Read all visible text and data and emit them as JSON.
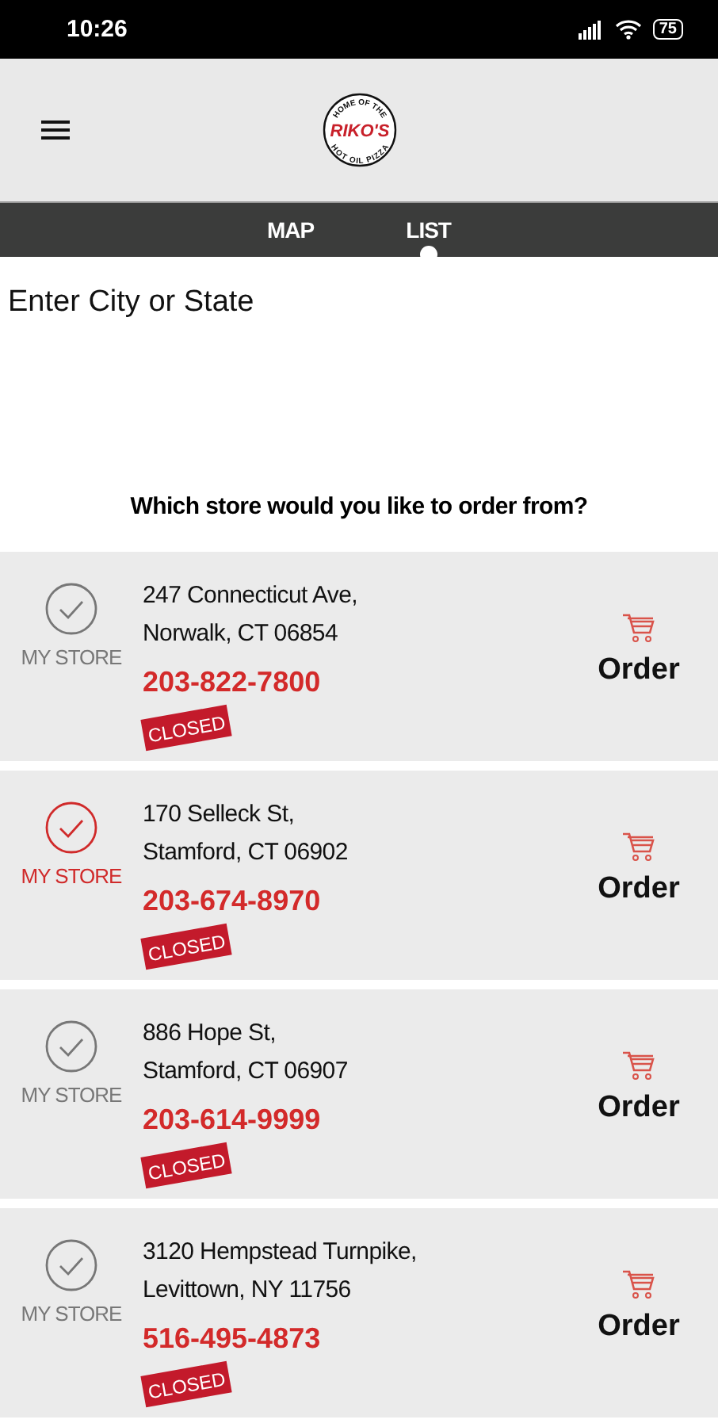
{
  "status_bar": {
    "time": "10:26",
    "battery": "75"
  },
  "header": {
    "logo": {
      "top": "HOME OF THE",
      "name": "RIKO'S",
      "bottom": "HOT OIL PIZZA"
    }
  },
  "tabs": [
    {
      "label": "MAP",
      "selected": false
    },
    {
      "label": "LIST",
      "selected": true
    }
  ],
  "search": {
    "placeholder": "Enter City or State"
  },
  "prompt": "Which store would you like to order from?",
  "stores": [
    {
      "address_line_1": "247 Connecticut Ave,",
      "address_line_2": "Norwalk, CT 06854",
      "phone": "203-822-7800",
      "status": "CLOSED",
      "my_store_label": "MY STORE",
      "selected": false,
      "order_label": "Order"
    },
    {
      "address_line_1": "170 Selleck St,",
      "address_line_2": "Stamford, CT 06902",
      "phone": "203-674-8970",
      "status": "CLOSED",
      "my_store_label": "MY STORE",
      "selected": true,
      "order_label": "Order"
    },
    {
      "address_line_1": "886 Hope St,",
      "address_line_2": "Stamford, CT 06907",
      "phone": "203-614-9999",
      "status": "CLOSED",
      "my_store_label": "MY STORE",
      "selected": false,
      "order_label": "Order"
    },
    {
      "address_line_1": "3120 Hempstead Turnpike,",
      "address_line_2": "Levittown, NY 11756",
      "phone": "516-495-4873",
      "status": "CLOSED",
      "my_store_label": "MY STORE",
      "selected": false,
      "order_label": "Order"
    }
  ]
}
